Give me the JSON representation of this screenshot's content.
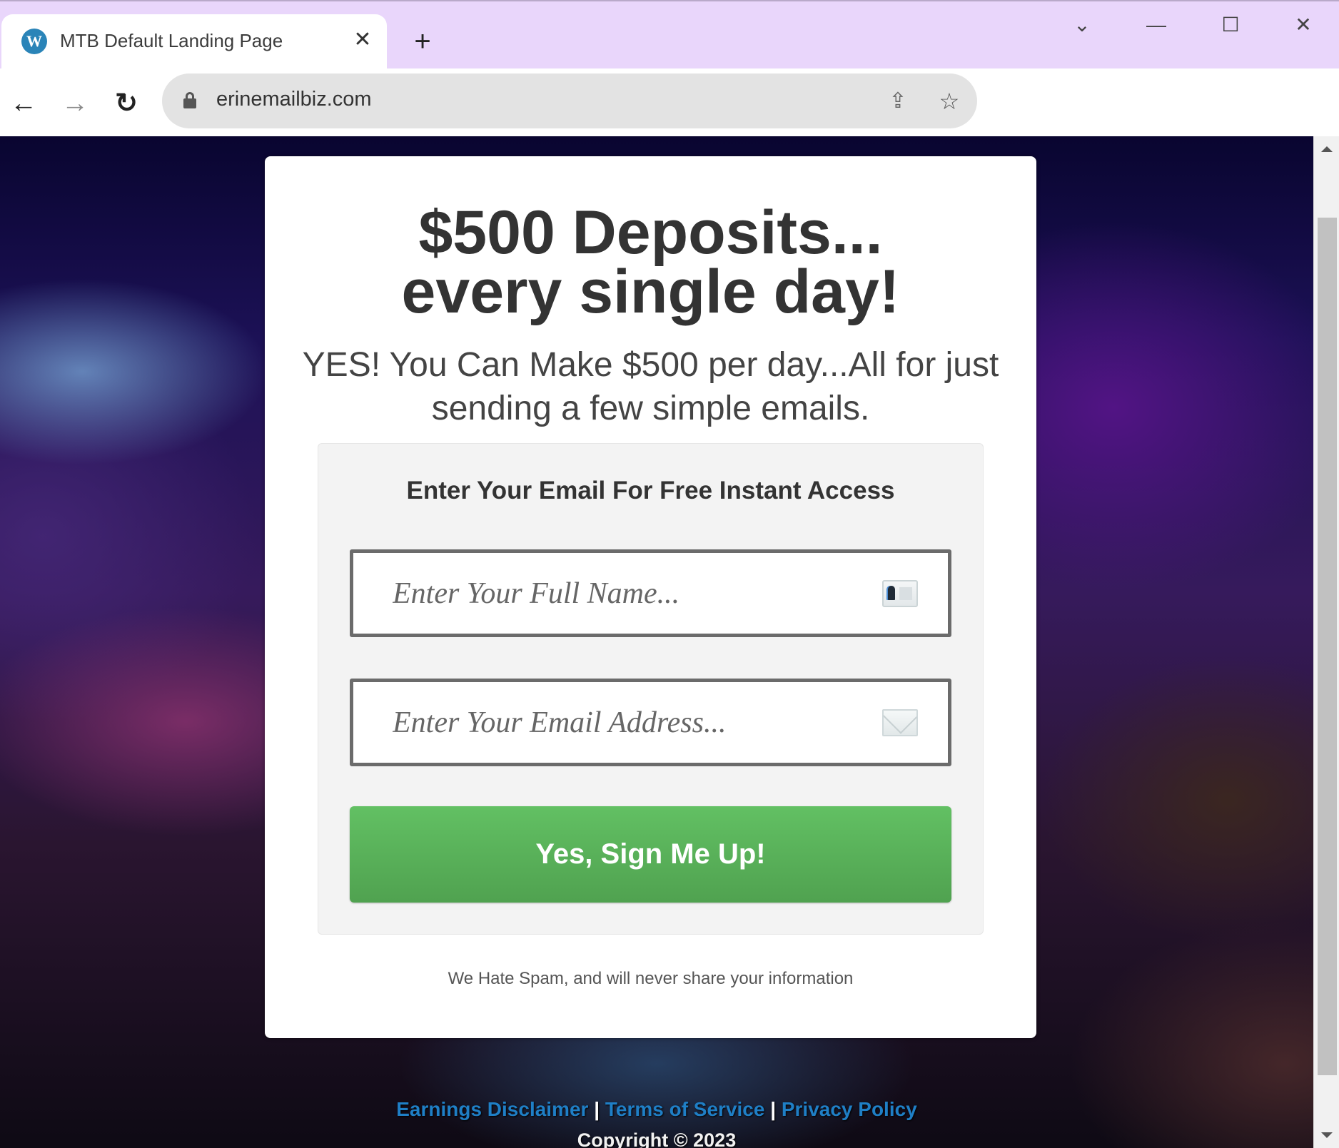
{
  "browser": {
    "tab": {
      "title": "MTB Default Landing Page",
      "favicon": "wordpress-icon",
      "close_glyph": "✕"
    },
    "new_tab_glyph": "+",
    "window_controls": {
      "menu": "⌄",
      "minimize": "—",
      "maximize": "☐",
      "close": "✕"
    },
    "nav": {
      "back": "←",
      "forward": "→",
      "reload": "↻"
    },
    "address_bar": {
      "url": "erinemailbiz.com",
      "secure": true
    },
    "toolbar_icons": {
      "share": "⇪",
      "bookmark": "☆"
    }
  },
  "page": {
    "headline_line1": "$500 Deposits...",
    "headline_line2": "every single day!",
    "subheadline": "YES! You Can Make $500 per day...All for just sending a few simple emails.",
    "form": {
      "title": "Enter Your Email For Free Instant Access",
      "name_field": {
        "placeholder": "Enter Your Full Name...",
        "value": "",
        "icon": "id-card-icon"
      },
      "email_field": {
        "placeholder": "Enter Your Email Address...",
        "value": "",
        "icon": "envelope-icon"
      },
      "submit_label": "Yes, Sign Me Up!"
    },
    "spam_note": "We Hate Spam, and will never share your information",
    "footer": {
      "links": [
        "Earnings Disclaimer",
        "Terms of Service",
        "Privacy Policy"
      ],
      "separator": "|",
      "copyright": "Copyright © 2023"
    }
  },
  "colors": {
    "tabstrip": "#e9d6fb",
    "button_green": "#5bb25c",
    "footer_link": "#1f7fc6",
    "heading_text": "#333333"
  }
}
